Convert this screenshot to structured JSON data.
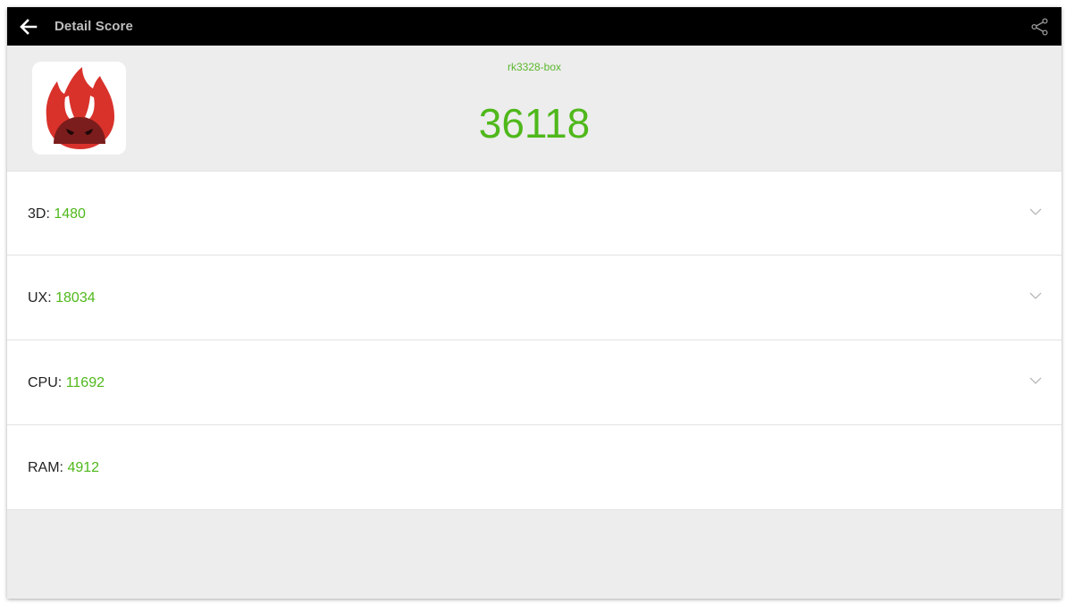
{
  "appbar": {
    "title": "Detail Score",
    "back_icon": "arrow-back-icon",
    "share_icon": "share-icon"
  },
  "header": {
    "device_name": "rk3328-box",
    "total_score": "36118",
    "logo_icon": "antutu-logo-icon"
  },
  "scores": [
    {
      "label": "3D:",
      "value": "1480",
      "expandable": true
    },
    {
      "label": "UX:",
      "value": "18034",
      "expandable": true
    },
    {
      "label": "CPU:",
      "value": "11692",
      "expandable": true
    },
    {
      "label": "RAM:",
      "value": "4912",
      "expandable": false
    }
  ],
  "colors": {
    "accent_green": "#4fb81b",
    "appbar_bg": "#000000",
    "logo_red": "#d9322b",
    "background": "#ededed"
  }
}
